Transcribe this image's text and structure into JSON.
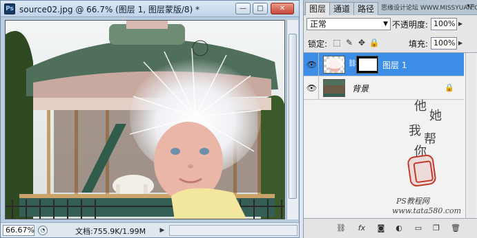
{
  "document": {
    "title": "source02.jpg @ 66.7% (图层 1, 图层蒙版/8) *",
    "app_icon": "Ps",
    "zoom": "66.67%",
    "doc_info": "文档:755.9K/1.99M",
    "buttons": {
      "minimize": "—",
      "maximize": "□",
      "close": "✕"
    }
  },
  "panel": {
    "tabs": [
      "图层",
      "通道",
      "路径"
    ],
    "header_watermark": "思缘设计论坛 WWW.MISSYUAN.COM",
    "blend_mode": "正常",
    "opacity_label": "不透明度:",
    "opacity_value": "100%",
    "lock_label": "锁定:",
    "fill_label": "填充:",
    "fill_value": "100%",
    "layers": [
      {
        "name": "图层 1",
        "selected": true,
        "visible": true,
        "has_mask": true
      },
      {
        "name": "背景",
        "selected": false,
        "visible": true,
        "locked": true
      }
    ],
    "footer_buttons": [
      "link-icon",
      "fx-icon",
      "mask-icon",
      "adjustment-icon",
      "folder-icon",
      "new-layer-icon",
      "trash-icon"
    ]
  },
  "watermark": {
    "calligraphy": [
      "他",
      "她",
      "我",
      "帮",
      "你"
    ],
    "line1": "PS教程网",
    "line2": "www.tata580.com"
  },
  "colors": {
    "selected_layer": "#3d8ee6",
    "title_gradient_top": "#dbe8f5",
    "seal_red": "#c43a2a"
  }
}
